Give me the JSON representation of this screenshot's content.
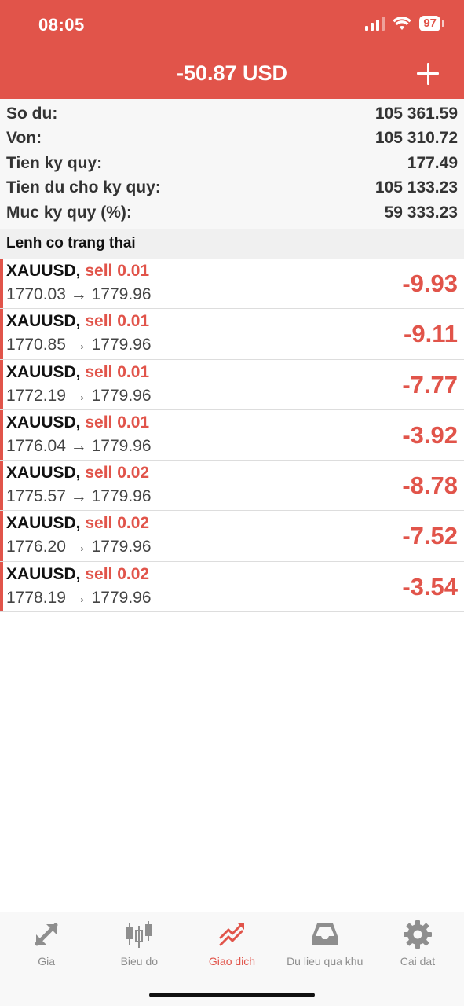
{
  "status": {
    "time": "08:05",
    "battery": "97"
  },
  "header": {
    "title": "-50.87 USD",
    "add_label": "+"
  },
  "summary": [
    {
      "label": "So du:",
      "value": "105 361.59"
    },
    {
      "label": "Von:",
      "value": "105 310.72"
    },
    {
      "label": "Tien ky quy:",
      "value": "177.49"
    },
    {
      "label": "Tien du cho ky quy:",
      "value": "105 133.23"
    },
    {
      "label": "Muc ky quy (%):",
      "value": "59 333.23"
    }
  ],
  "section": {
    "title": "Lenh co trang thai"
  },
  "orders": [
    {
      "symbol": "XAUUSD,",
      "side": "sell 0.01",
      "open": "1770.03",
      "current": "1779.96",
      "profit": "-9.93"
    },
    {
      "symbol": "XAUUSD,",
      "side": "sell 0.01",
      "open": "1770.85",
      "current": "1779.96",
      "profit": "-9.11"
    },
    {
      "symbol": "XAUUSD,",
      "side": "sell 0.01",
      "open": "1772.19",
      "current": "1779.96",
      "profit": "-7.77"
    },
    {
      "symbol": "XAUUSD,",
      "side": "sell 0.01",
      "open": "1776.04",
      "current": "1779.96",
      "profit": "-3.92"
    },
    {
      "symbol": "XAUUSD,",
      "side": "sell 0.02",
      "open": "1775.57",
      "current": "1779.96",
      "profit": "-8.78"
    },
    {
      "symbol": "XAUUSD,",
      "side": "sell 0.02",
      "open": "1776.20",
      "current": "1779.96",
      "profit": "-7.52"
    },
    {
      "symbol": "XAUUSD,",
      "side": "sell 0.02",
      "open": "1778.19",
      "current": "1779.96",
      "profit": "-3.54"
    }
  ],
  "arrow": "→",
  "tabs": [
    {
      "label": "Gia",
      "icon": "quotes-icon",
      "active": false
    },
    {
      "label": "Bieu do",
      "icon": "candlestick-icon",
      "active": false
    },
    {
      "label": "Giao dich",
      "icon": "trade-icon",
      "active": true
    },
    {
      "label": "Du lieu qua khu",
      "icon": "history-inbox-icon",
      "active": false
    },
    {
      "label": "Cai dat",
      "icon": "gear-icon",
      "active": false
    }
  ],
  "colors": {
    "accent": "#e1544a",
    "inactive": "#8e8e8e"
  }
}
